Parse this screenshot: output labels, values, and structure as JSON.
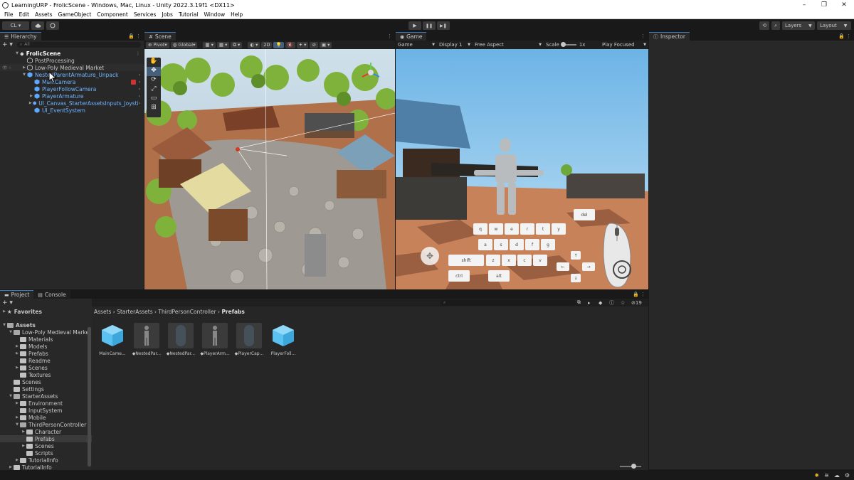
{
  "window": {
    "title": "LearningURP - FrolicScene - Windows, Mac, Linux - Unity 2022.3.19f1 <DX11>",
    "controls": [
      "–",
      "❐",
      "✕"
    ]
  },
  "menu": [
    "File",
    "Edit",
    "Assets",
    "GameObject",
    "Component",
    "Services",
    "Jobs",
    "Tutorial",
    "Window",
    "Help"
  ],
  "toolbar": {
    "account": "CL ▾",
    "cloud_icon": "cloud-icon",
    "collab_icon": "collab-icon",
    "play": "▶",
    "pause": "❚❚",
    "step": "▶❚",
    "layers": "Layers",
    "layout": "Layout"
  },
  "hierarchy": {
    "tab": "Hierarchy",
    "search_placeholder": "All",
    "scene": "FrolicScene",
    "items": [
      {
        "label": "PostProcessing"
      },
      {
        "label": "Low-Poly Medieval Market"
      },
      {
        "label": "NestedParentArmature_Unpack"
      },
      {
        "label": "MainCamera"
      },
      {
        "label": "PlayerFollowCamera"
      },
      {
        "label": "PlayerArmature"
      },
      {
        "label": "UI_Canvas_StarterAssetsInputs_Joysti"
      },
      {
        "label": "UI_EventSystem"
      }
    ]
  },
  "scene": {
    "tab": "Scene",
    "pivot": "Pivot",
    "global": "Global",
    "mode2d": "2D"
  },
  "game": {
    "tab": "Game",
    "mode": "Game",
    "display": "Display 1",
    "aspect": "Free Aspect",
    "scale_label": "Scale",
    "scale_value": "1x",
    "play_focused": "Play Focused",
    "keys": {
      "row1": [
        "q",
        "w",
        "e",
        "r",
        "t",
        "y"
      ],
      "row2": [
        "a",
        "s",
        "d",
        "f",
        "g"
      ],
      "row3": [
        "z",
        "x",
        "c",
        "v"
      ],
      "shift": "shift",
      "ctrl": "ctrl",
      "alt": "alt",
      "del": "del",
      "left": "←",
      "right": "→",
      "up": "↑",
      "down": "↓"
    }
  },
  "inspector": {
    "tab": "Inspector"
  },
  "project": {
    "tabs": [
      "Project",
      "Console"
    ],
    "favorites": "Favorites",
    "assets_root": "Assets",
    "tree": [
      {
        "label": "Low-Poly Medieval Marke",
        "depth": 1,
        "arrow": "▼"
      },
      {
        "label": "Materials",
        "depth": 2,
        "arrow": ""
      },
      {
        "label": "Models",
        "depth": 2,
        "arrow": "▶"
      },
      {
        "label": "Prefabs",
        "depth": 2,
        "arrow": "▶"
      },
      {
        "label": "Readme",
        "depth": 2,
        "arrow": ""
      },
      {
        "label": "Scenes",
        "depth": 2,
        "arrow": "▶"
      },
      {
        "label": "Textures",
        "depth": 2,
        "arrow": ""
      },
      {
        "label": "Scenes",
        "depth": 1,
        "arrow": ""
      },
      {
        "label": "Settings",
        "depth": 1,
        "arrow": ""
      },
      {
        "label": "StarterAssets",
        "depth": 1,
        "arrow": "▼"
      },
      {
        "label": "Environment",
        "depth": 2,
        "arrow": "▶"
      },
      {
        "label": "InputSystem",
        "depth": 2,
        "arrow": ""
      },
      {
        "label": "Mobile",
        "depth": 2,
        "arrow": "▶"
      },
      {
        "label": "ThirdPersonController",
        "depth": 2,
        "arrow": "▼"
      },
      {
        "label": "Character",
        "depth": 3,
        "arrow": "▶"
      },
      {
        "label": "Prefabs",
        "depth": 3,
        "arrow": "",
        "selected": true
      },
      {
        "label": "Scenes",
        "depth": 3,
        "arrow": "▶"
      },
      {
        "label": "Scripts",
        "depth": 3,
        "arrow": ""
      },
      {
        "label": "TutorialInfo",
        "depth": 2,
        "arrow": "▶"
      },
      {
        "label": "TutorialInfo",
        "depth": 1,
        "arrow": "▶"
      }
    ],
    "breadcrumb": [
      "Assets",
      "StarterAssets",
      "ThirdPersonController",
      "Prefabs"
    ],
    "hidden_count": "19",
    "assets": [
      {
        "label": "MainCame...",
        "kind": "cube"
      },
      {
        "label": "NestedPar...",
        "kind": "figure"
      },
      {
        "label": "NestedPar...",
        "kind": "capsule"
      },
      {
        "label": "PlayerArm...",
        "kind": "figure"
      },
      {
        "label": "PlayerCap...",
        "kind": "capsule"
      },
      {
        "label": "PlayerFoll...",
        "kind": "cube"
      }
    ]
  }
}
